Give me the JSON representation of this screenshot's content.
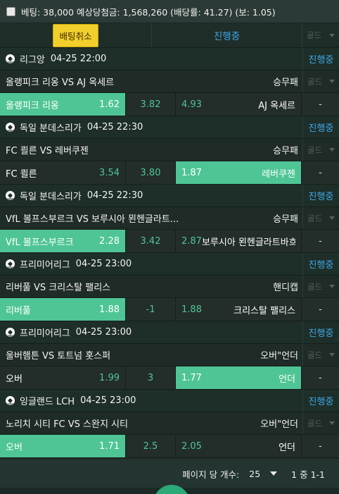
{
  "topbar": {
    "summary": "베팅: 38,000 예상당첨금: 1,568,260 (배당률: 41.27) (보: 1.05)"
  },
  "header": {
    "cancel_label": "배팅취소",
    "status_label": "진행중",
    "gold_label": "골드"
  },
  "matches": [
    {
      "league": "리그앙",
      "time": "04-25 22:00",
      "status": "진행중",
      "title": "올랭피크 리옹 VS AJ 옥세르",
      "market": "승무패",
      "gold": "골드",
      "home": "올랭피크 리옹",
      "home_odd": "1.62",
      "draw": "3.82",
      "away_odd": "4.93",
      "away": "AJ 옥세르",
      "dash": "-",
      "selected": "home"
    },
    {
      "league": "독일 분데스리가",
      "time": "04-25 22:30",
      "status": "진행중",
      "title": "FC 쾰른 VS 레버쿠젠",
      "market": "승무패",
      "gold": "골드",
      "home": "FC 쾰른",
      "home_odd": "3.54",
      "draw": "3.80",
      "away_odd": "1.87",
      "away": "레버쿠젠",
      "dash": "-",
      "selected": "away"
    },
    {
      "league": "독일 분데스리가",
      "time": "04-25 22:30",
      "status": "진행중",
      "title": "VfL 볼프스부르크 VS 보루시아 묀헨글라트...",
      "market": "승무패",
      "gold": "골드",
      "home": "VfL 볼프스부르크",
      "home_odd": "2.28",
      "draw": "3.42",
      "away_odd": "2.87",
      "away": "보루시아 묀헨글라트바흐",
      "dash": "-",
      "selected": "home"
    },
    {
      "league": "프리미어리그",
      "time": "04-25 23:00",
      "status": "진행중",
      "title": "리버풀 VS 크리스탈 팰리스",
      "market": "핸디캡",
      "gold": "골드",
      "home": "리버풀",
      "home_odd": "1.88",
      "draw": "-1",
      "away_odd": "1.88",
      "away": "크리스탈 팰리스",
      "dash": "-",
      "selected": "home"
    },
    {
      "league": "프리미어리그",
      "time": "04-25 23:00",
      "status": "진행중",
      "title": "울버햄튼 VS 토트넘 홋스퍼",
      "market": "오버\"언더",
      "gold": "골드",
      "home": "오버",
      "home_odd": "1.99",
      "draw": "3",
      "away_odd": "1.77",
      "away": "언더",
      "dash": "-",
      "selected": "away"
    },
    {
      "league": "잉글랜드 LCH",
      "time": "04-25 23:00",
      "status": "진행중",
      "title": "노리치 시티 FC VS 스완지 시티",
      "market": "오버\"언더",
      "gold": "골드",
      "home": "오버",
      "home_odd": "1.71",
      "draw": "2.5",
      "away_odd": "2.05",
      "away": "언더",
      "dash": "-",
      "selected": "home"
    }
  ],
  "footer": {
    "per_page_label": "페이지 당 개수:",
    "per_page_value": "25",
    "range": "1 중 1-1"
  },
  "colors": {
    "accent": "#4fc595",
    "status_blue": "#3ea8e6",
    "cancel_yellow": "#f2cf2c"
  }
}
